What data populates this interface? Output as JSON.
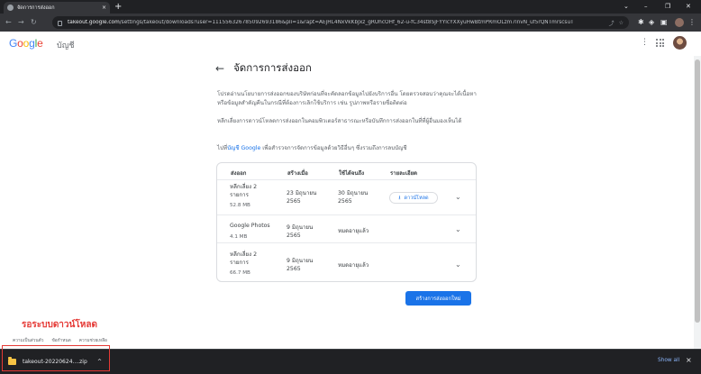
{
  "browser": {
    "tab_title": "จัดการการส่งออก",
    "tab_close": "×",
    "new_tab": "+",
    "url_host": "takeout.google.com",
    "url_path": "/settings/takeout/downloads?user=111556326785092693186&pli=1&rapt=AEjHL4NxVkKbJxz_gRUhcOHf_62-u-fC34st8SjFYYlcYXXyuHwBtmPRmOLzm7lnvN_uf5rQNTmrscsuT",
    "window_controls": [
      "⌄",
      "–",
      "❐",
      "✕"
    ]
  },
  "appbar": {
    "logo_letters": [
      {
        "ch": "G",
        "color": "#4285F4"
      },
      {
        "ch": "o",
        "color": "#EA4335"
      },
      {
        "ch": "o",
        "color": "#FBBC05"
      },
      {
        "ch": "g",
        "color": "#4285F4"
      },
      {
        "ch": "l",
        "color": "#34A853"
      },
      {
        "ch": "e",
        "color": "#EA4335"
      }
    ],
    "product": "บัญชี"
  },
  "page": {
    "title": "จัดการการส่งออก",
    "para1": "โปรดอ่านนโยบายการส่งออกของบริษัทก่อนที่จะคัดลอกข้อมูลไปยังบริการอื่น โดยตรวจสอบว่าคุณจะได้เนื้อหาหรือข้อมูลสำคัญคืนในกรณีที่ต้องการเลิกใช้บริการ เช่น รูปภาพหรือรายชื่อติดต่อ",
    "para2": "หลีกเลี่ยงการดาวน์โหลดการส่งออกในคอมพิวเตอร์สาธารณะหรือบันทึกการส่งออกในที่ที่ผู้อื่นมองเห็นได้",
    "para3_prefix": "ไปที่",
    "para3_link": "บัญชี Google",
    "para3_suffix": " เพื่อสำรวจการจัดการข้อมูลด้วยวิธีอื่นๆ ซึ่งรวมถึงการลบบัญชี"
  },
  "exports": {
    "headers": [
      "ส่งออก",
      "สร้างเมื่อ",
      "ใช้ได้จนถึง",
      "รายละเอียด"
    ],
    "rows": [
      {
        "name": "หลีกเลี่ยง 2 รายการ",
        "size": "52.8 MB",
        "created": "23 มิถุนายน 2565",
        "until": "30 มิถุนายน 2565",
        "action": "ดาวน์โหลด"
      },
      {
        "name": "Google Photos",
        "size": "4.1 MB",
        "created": "9 มิถุนายน 2565",
        "until": "หมดอายุแล้ว",
        "action": ""
      },
      {
        "name": "หลีกเลี่ยง 2 รายการ",
        "size": "66.7 MB",
        "created": "9 มิถุนายน 2565",
        "until": "หมดอายุแล้ว",
        "action": ""
      }
    ],
    "create_label": "สร้างการส่งออกใหม่"
  },
  "annotation": "รอระบบดาวน์โหลด",
  "footer": [
    "ความเป็นส่วนตัว",
    "ข้อกำหนด",
    "ความช่วยเหลือ"
  ],
  "download_bar": {
    "file_name": "takeout-20220624....zip",
    "caret": "^",
    "show_all": "Show all",
    "close": "×"
  },
  "colors": {
    "accent": "#1a73e8",
    "annotation": "#e53935"
  },
  "icons": [
    "back-arrow-icon",
    "download-icon",
    "chevron-down-icon",
    "folder-zip-icon",
    "lock-icon",
    "apps-grid-icon",
    "more-vert-icon"
  ]
}
